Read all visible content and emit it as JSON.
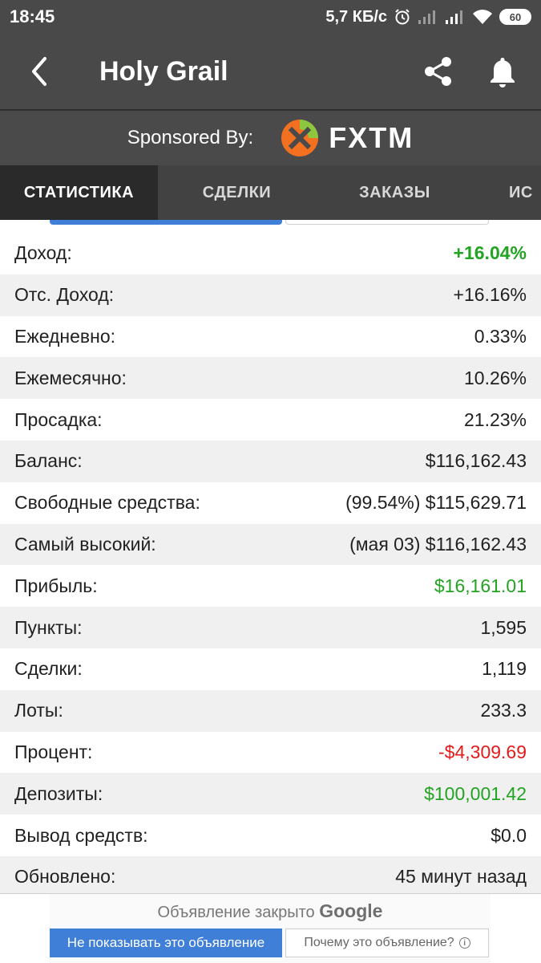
{
  "status_bar": {
    "time": "18:45",
    "network_speed": "5,7 КБ/с",
    "battery": "60",
    "icons": [
      "alarm-icon",
      "signal-icon",
      "signal-icon",
      "wifi-icon",
      "battery-icon"
    ]
  },
  "app_bar": {
    "title": "Holy Grail",
    "icons": [
      "back-arrow-icon",
      "share-icon",
      "bell-icon"
    ]
  },
  "sponsor": {
    "label": "Sponsored By:",
    "brand": "FXTM",
    "brand_colors": {
      "orange": "#f37021",
      "green": "#8dc63f"
    }
  },
  "tabs": [
    {
      "label": "СТАТИСТИКА",
      "active": true
    },
    {
      "label": "СДЕЛКИ",
      "active": false
    },
    {
      "label": "ЗАКАЗЫ",
      "active": false
    },
    {
      "label": "ИС",
      "active": false
    }
  ],
  "stats": [
    {
      "label": "Доход:",
      "value": "+16.04%",
      "style": "green-bold"
    },
    {
      "label": "Отс. Доход:",
      "value": "+16.16%",
      "style": "normal"
    },
    {
      "label": "Ежедневно:",
      "value": "0.33%",
      "style": "normal"
    },
    {
      "label": "Ежемесячно:",
      "value": "10.26%",
      "style": "normal"
    },
    {
      "label": "Просадка:",
      "value": "21.23%",
      "style": "normal"
    },
    {
      "label": "Баланс:",
      "value": "$116,162.43",
      "style": "normal"
    },
    {
      "label": "Свободные средства:",
      "value": "(99.54%) $115,629.71",
      "style": "normal"
    },
    {
      "label": "Самый высокий:",
      "value": "(мая 03) $116,162.43",
      "style": "normal"
    },
    {
      "label": "Прибыль:",
      "value": "$16,161.01",
      "style": "green"
    },
    {
      "label": "Пункты:",
      "value": "1,595",
      "style": "normal"
    },
    {
      "label": "Сделки:",
      "value": "1,119",
      "style": "normal"
    },
    {
      "label": "Лоты:",
      "value": "233.3",
      "style": "normal"
    },
    {
      "label": "Процент:",
      "value": "-$4,309.69",
      "style": "red"
    },
    {
      "label": "Депозиты:",
      "value": "$100,001.42",
      "style": "green"
    },
    {
      "label": "Вывод средств:",
      "value": "$0.0",
      "style": "normal"
    },
    {
      "label": "Обновлено:",
      "value": "45 минут назад",
      "style": "normal"
    }
  ],
  "colors": {
    "header_bg": "#494949",
    "tab_active_bg": "#2a2a2a",
    "positive": "#22a322",
    "negative": "#e41b1b",
    "ad_button": "#3f7fd8"
  },
  "ad": {
    "closed_text": "Объявление закрыто",
    "google": "Google",
    "hide_button": "Не показывать это объявление",
    "why_button": "Почему это объявление?"
  }
}
